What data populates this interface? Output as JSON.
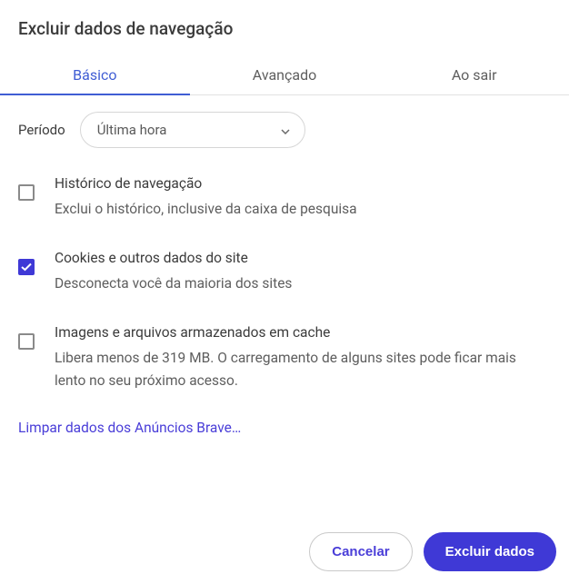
{
  "dialog": {
    "title": "Excluir dados de navegação"
  },
  "tabs": {
    "basic": "Básico",
    "advanced": "Avançado",
    "onExit": "Ao sair"
  },
  "period": {
    "label": "Período",
    "selected": "Última hora"
  },
  "options": {
    "history": {
      "title": "Histórico de navegação",
      "desc": "Exclui o histórico, inclusive da caixa de pesquisa",
      "checked": false
    },
    "cookies": {
      "title": "Cookies e outros dados do site",
      "desc": "Desconecta você da maioria dos sites",
      "checked": true
    },
    "cache": {
      "title": "Imagens e arquivos armazenados em cache",
      "desc": "Libera menos de 319 MB. O carregamento de alguns sites pode ficar mais lento no seu próximo acesso.",
      "checked": false
    }
  },
  "braveLink": "Limpar dados dos Anúncios Brave…",
  "buttons": {
    "cancel": "Cancelar",
    "confirm": "Excluir dados"
  }
}
